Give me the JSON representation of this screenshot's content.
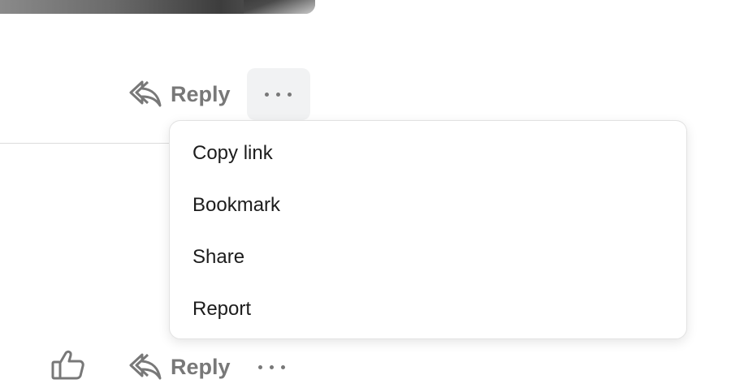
{
  "comment_actions": {
    "reply_label": "Reply"
  },
  "next_comment_actions": {
    "reply_label": "Reply"
  },
  "menu": {
    "items": [
      {
        "label": "Copy link"
      },
      {
        "label": "Bookmark"
      },
      {
        "label": "Share"
      },
      {
        "label": "Report"
      }
    ]
  },
  "icons": {
    "reply": "reply-arrow-icon",
    "more": "ellipsis-icon",
    "like": "thumbs-up-icon"
  },
  "colors": {
    "action_text": "#787878",
    "menu_text": "#1c1c1c",
    "active_bg": "#f1f2f3"
  }
}
